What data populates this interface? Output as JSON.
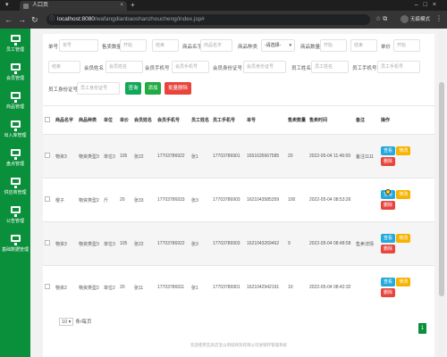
{
  "browser": {
    "tab_title": "人口页",
    "url_host": "localhost:8080",
    "url_path": "/wafangdianbaoshanzhoucheng/index.jsp#",
    "profile_label": "无痕模式"
  },
  "sidebar": {
    "items": [
      {
        "label": "员工管理"
      },
      {
        "label": "会员管理"
      },
      {
        "label": "商品管理"
      },
      {
        "label": "出入库管理"
      },
      {
        "label": "盘点管理"
      },
      {
        "label": "供应商管理"
      },
      {
        "label": "公告管理"
      },
      {
        "label": "基础数据管理"
      }
    ]
  },
  "filters": {
    "row1": [
      {
        "label": "单号",
        "placeholder": "单号"
      },
      {
        "label": "售卖数量",
        "placeholder": "开始"
      },
      {
        "label": "",
        "placeholder": "结束"
      },
      {
        "label": "商品名字",
        "placeholder": "商品名字"
      },
      {
        "label": "商品种类",
        "value": "-请选择-"
      },
      {
        "label": "商品数量",
        "placeholder": "开始"
      },
      {
        "label": "",
        "placeholder": "结束"
      },
      {
        "label": "单价",
        "placeholder": "开始"
      }
    ],
    "row2": [
      {
        "label": "",
        "placeholder": "结束"
      },
      {
        "label": "会员姓名",
        "placeholder": "会员姓名"
      },
      {
        "label": "会员手机号",
        "placeholder": "会员手机号"
      },
      {
        "label": "会员身份证号",
        "placeholder": "会员身份证号"
      },
      {
        "label": "员工姓名",
        "placeholder": "员工姓名"
      },
      {
        "label": "员工手机号",
        "placeholder": "员工手机号"
      }
    ],
    "row3": [
      {
        "label": "员工身份证号",
        "placeholder": "员工身份证号"
      }
    ],
    "buttons": {
      "query": "查询",
      "add": "添加",
      "batch_delete": "批量删除"
    }
  },
  "table": {
    "headers": [
      "",
      "商品名字",
      "商品种类",
      "单位",
      "单价",
      "会员姓名",
      "会员手机号",
      "员工姓名",
      "员工手机号",
      "单号",
      "售卖数量",
      "售卖时间",
      "备注",
      "操作"
    ],
    "rows": [
      {
        "cells": [
          "物资3",
          "物资类型3",
          "单位3",
          "105",
          "张22",
          "17703786922",
          "张1",
          "17703786901",
          "1651635667585",
          "20",
          "2022-05-04 11:46:09",
          "备注1111"
        ]
      },
      {
        "cells": [
          "棍子",
          "物资类型2",
          "斤",
          "20",
          "张33",
          "17703786933",
          "张3",
          "17703786903",
          "1621043585359",
          "100",
          "2022-05-04 08:53:26",
          ""
        ]
      },
      {
        "cells": [
          "物资3",
          "物资类型3",
          "单位3",
          "105",
          "张22",
          "17703786922",
          "张3",
          "17703786903",
          "1621043269462",
          "9",
          "2022-05-04 08:48:58",
          "售卖详情"
        ]
      },
      {
        "cells": [
          "物资2",
          "物资类型2",
          "单位2",
          "20",
          "张11",
          "17703786911",
          "张1",
          "17703786901",
          "1621042942191",
          "10",
          "2022-05-04 08:42:32",
          ""
        ]
      }
    ],
    "action_labels": {
      "view": "查看",
      "edit": "修改",
      "delete": "删除"
    }
  },
  "pagination": {
    "page_size": "10",
    "page_size_suffix": "条/每页",
    "current_page": "1"
  },
  "footer": {
    "text": "欢迎使用瓦房店宝山周城商贸有限公司进销存管理系统"
  },
  "colors": {
    "sidebar": "#0a8f3a",
    "query": "#11a85a",
    "add": "#22aa44",
    "delete": "#e8453c",
    "view": "#23a9dc",
    "edit": "#f6b400"
  }
}
